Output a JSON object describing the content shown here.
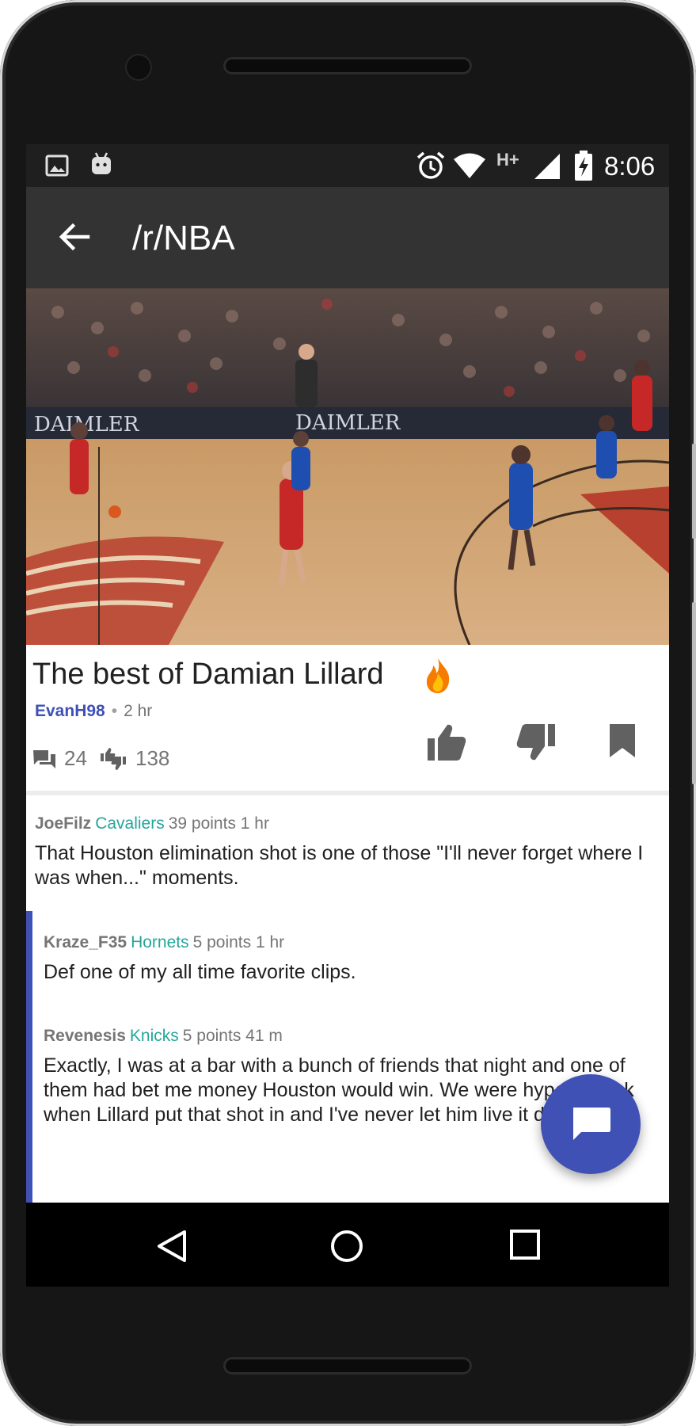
{
  "status_bar": {
    "time": "8:06",
    "network": "H+",
    "icons": [
      "image-notification-icon",
      "android-notification-icon",
      "alarm-icon",
      "wifi-icon",
      "signal-icon",
      "battery-charging-icon"
    ]
  },
  "app_bar": {
    "title": "/r/NBA",
    "back_icon": "arrow-back-icon"
  },
  "post": {
    "title": "The best of Damian Lillard",
    "title_emoji": "fire-icon",
    "author": "EvanH98",
    "separator": "•",
    "age": "2 hr",
    "comment_count": "24",
    "score": "138",
    "actions": [
      "upvote-icon",
      "downvote-icon",
      "bookmark-icon"
    ]
  },
  "comments": [
    {
      "user": "JoeFilz",
      "flair": "Cavaliers",
      "points": "39 points 1 hr",
      "body": "That Houston elimination shot is one of those \"I'll never forget where I was when...\" moments."
    },
    {
      "user": "Kraze_F35",
      "flair": "Hornets",
      "points": "5 points 1 hr",
      "body": "Def one of my all time favorite clips."
    },
    {
      "user": "Revenesis",
      "flair": "Knicks",
      "points": "5 points 41 m",
      "body": "Exactly, I was at a bar with a bunch of friends that night and one of them had bet me money Houston would win. We were hype as fuck when Lillard put that shot in and I've never let him live it down."
    }
  ],
  "fab": {
    "icon": "chat-bubble-icon"
  },
  "nav_bar": {
    "icons": [
      "back-triangle-icon",
      "home-circle-icon",
      "recents-square-icon"
    ]
  },
  "colors": {
    "accent": "#3f51b5",
    "flair": "#26a69a",
    "app_bar": "#333333",
    "status_bar": "#1f1f1f"
  }
}
